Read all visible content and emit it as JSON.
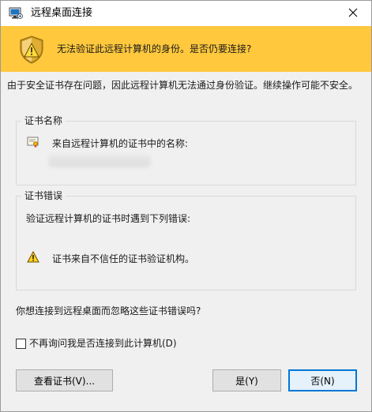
{
  "window": {
    "title": "远程桌面连接",
    "close_glyph": "✕"
  },
  "banner": {
    "message": "无法验证此远程计算机的身份。是否仍要连接?",
    "icon": "shield-warning-icon",
    "color": "#ffc83d"
  },
  "intro_text": "由于安全证书存在问题，因此远程计算机无法通过身份验证。继续操作可能不安全。",
  "certificate": {
    "group_title": "证书名称",
    "label": "来自远程计算机的证书中的名称:",
    "name_value": "redacted-host-name"
  },
  "errors": {
    "group_title": "证书错误",
    "description": "验证远程计算机的证书时遇到下列错误:",
    "items": [
      "证书来自不信任的证书验证机构。"
    ]
  },
  "question": "你想连接到远程桌面而忽略这些证书错误吗?",
  "checkbox": {
    "label": "不再询问我是否连接到此计算机(D)",
    "checked": false
  },
  "buttons": {
    "view_cert": "查看证书(V)...",
    "yes": "是(Y)",
    "no": "否(N)"
  },
  "colors": {
    "accent": "#0078d7",
    "warning": "#ffc83d"
  }
}
